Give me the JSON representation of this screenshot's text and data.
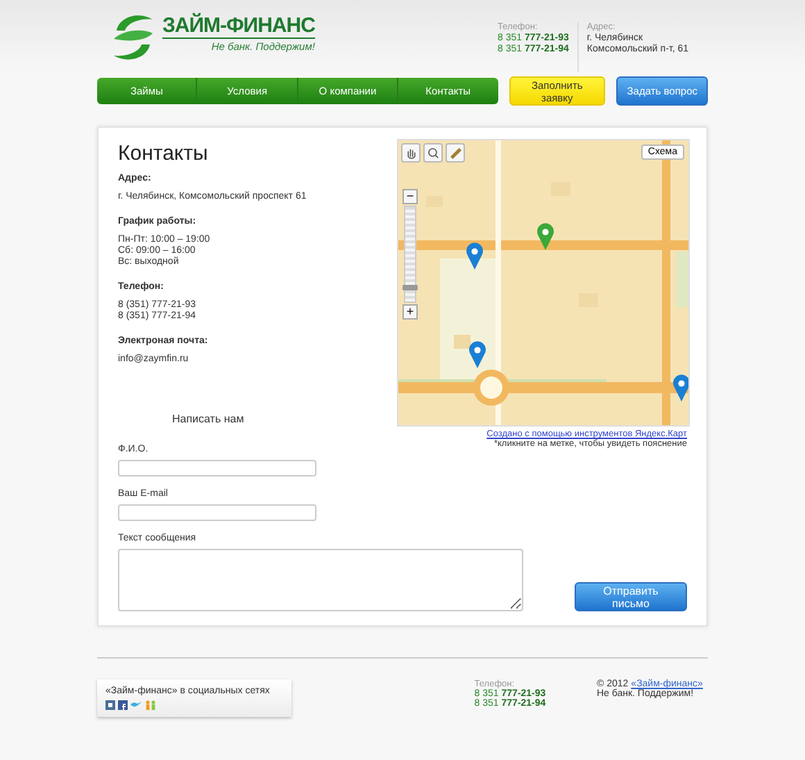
{
  "header": {
    "logo_title": "ЗАЙМ-ФИНАНС",
    "logo_tagline": "Не банк. Поддержим!",
    "phone_label": "Телефон:",
    "phones": [
      "8 351 **777-21-93**",
      "8 351 **777-21-94**"
    ],
    "address_label": "Адрес:",
    "address_lines": [
      "г. Челябинск",
      "Комсомольский п-т, 61"
    ]
  },
  "nav": [
    {
      "label": "Займы"
    },
    {
      "label": "Условия"
    },
    {
      "label": "О компании"
    },
    {
      "label": "Контакты"
    }
  ],
  "actions": [
    {
      "label": "Заполнить заявку",
      "kind": "apply"
    },
    {
      "label": "Задать вопрос",
      "kind": "ask"
    }
  ],
  "page": {
    "title": "Контакты",
    "sections": [
      {
        "heading": "Адрес:",
        "lines": [
          "г. Челябинск, Комсомольский проспект 61"
        ]
      },
      {
        "heading": "График работы:",
        "lines": [
          "Пн-Пт: 10:00 – 19:00",
          "Сб: 09:00 – 16:00",
          "Вс: выходной"
        ]
      },
      {
        "heading": "Телефон:",
        "lines": [
          "8 (351) 777-21-93",
          "8 (351) 777-21-94"
        ]
      },
      {
        "heading": "Электроная почта:",
        "lines": [
          "info@zaymfin.ru"
        ]
      }
    ]
  },
  "map": {
    "map_type": "Схема",
    "zoom": {
      "minus": "−",
      "plus": "+",
      "level": 0.12
    },
    "credit_link": "Создано с помощью инструментов Яндекс.Карт",
    "hint": "*кликните на метке, чтобы увидеть пояснение"
  },
  "form": {
    "title": "Написать нам",
    "fields": [
      {
        "label": "Ф.И.О.",
        "kind": "input"
      },
      {
        "label": "Ваш E-mail",
        "kind": "input"
      },
      {
        "label": "Текст сообщения",
        "kind": "textarea"
      }
    ],
    "submit": "Отправить письмо"
  },
  "footer": {
    "social_title": "«Займ-финанс» в социальных сетях",
    "phone_label": "Телефон:",
    "phones": [
      "8 351 **777-21-93**",
      "8 351 **777-21-94**"
    ],
    "copyright": "© 2012",
    "copyright_link": "«Займ-финанс»",
    "slogan": "Не банк. Поддержим!"
  }
}
